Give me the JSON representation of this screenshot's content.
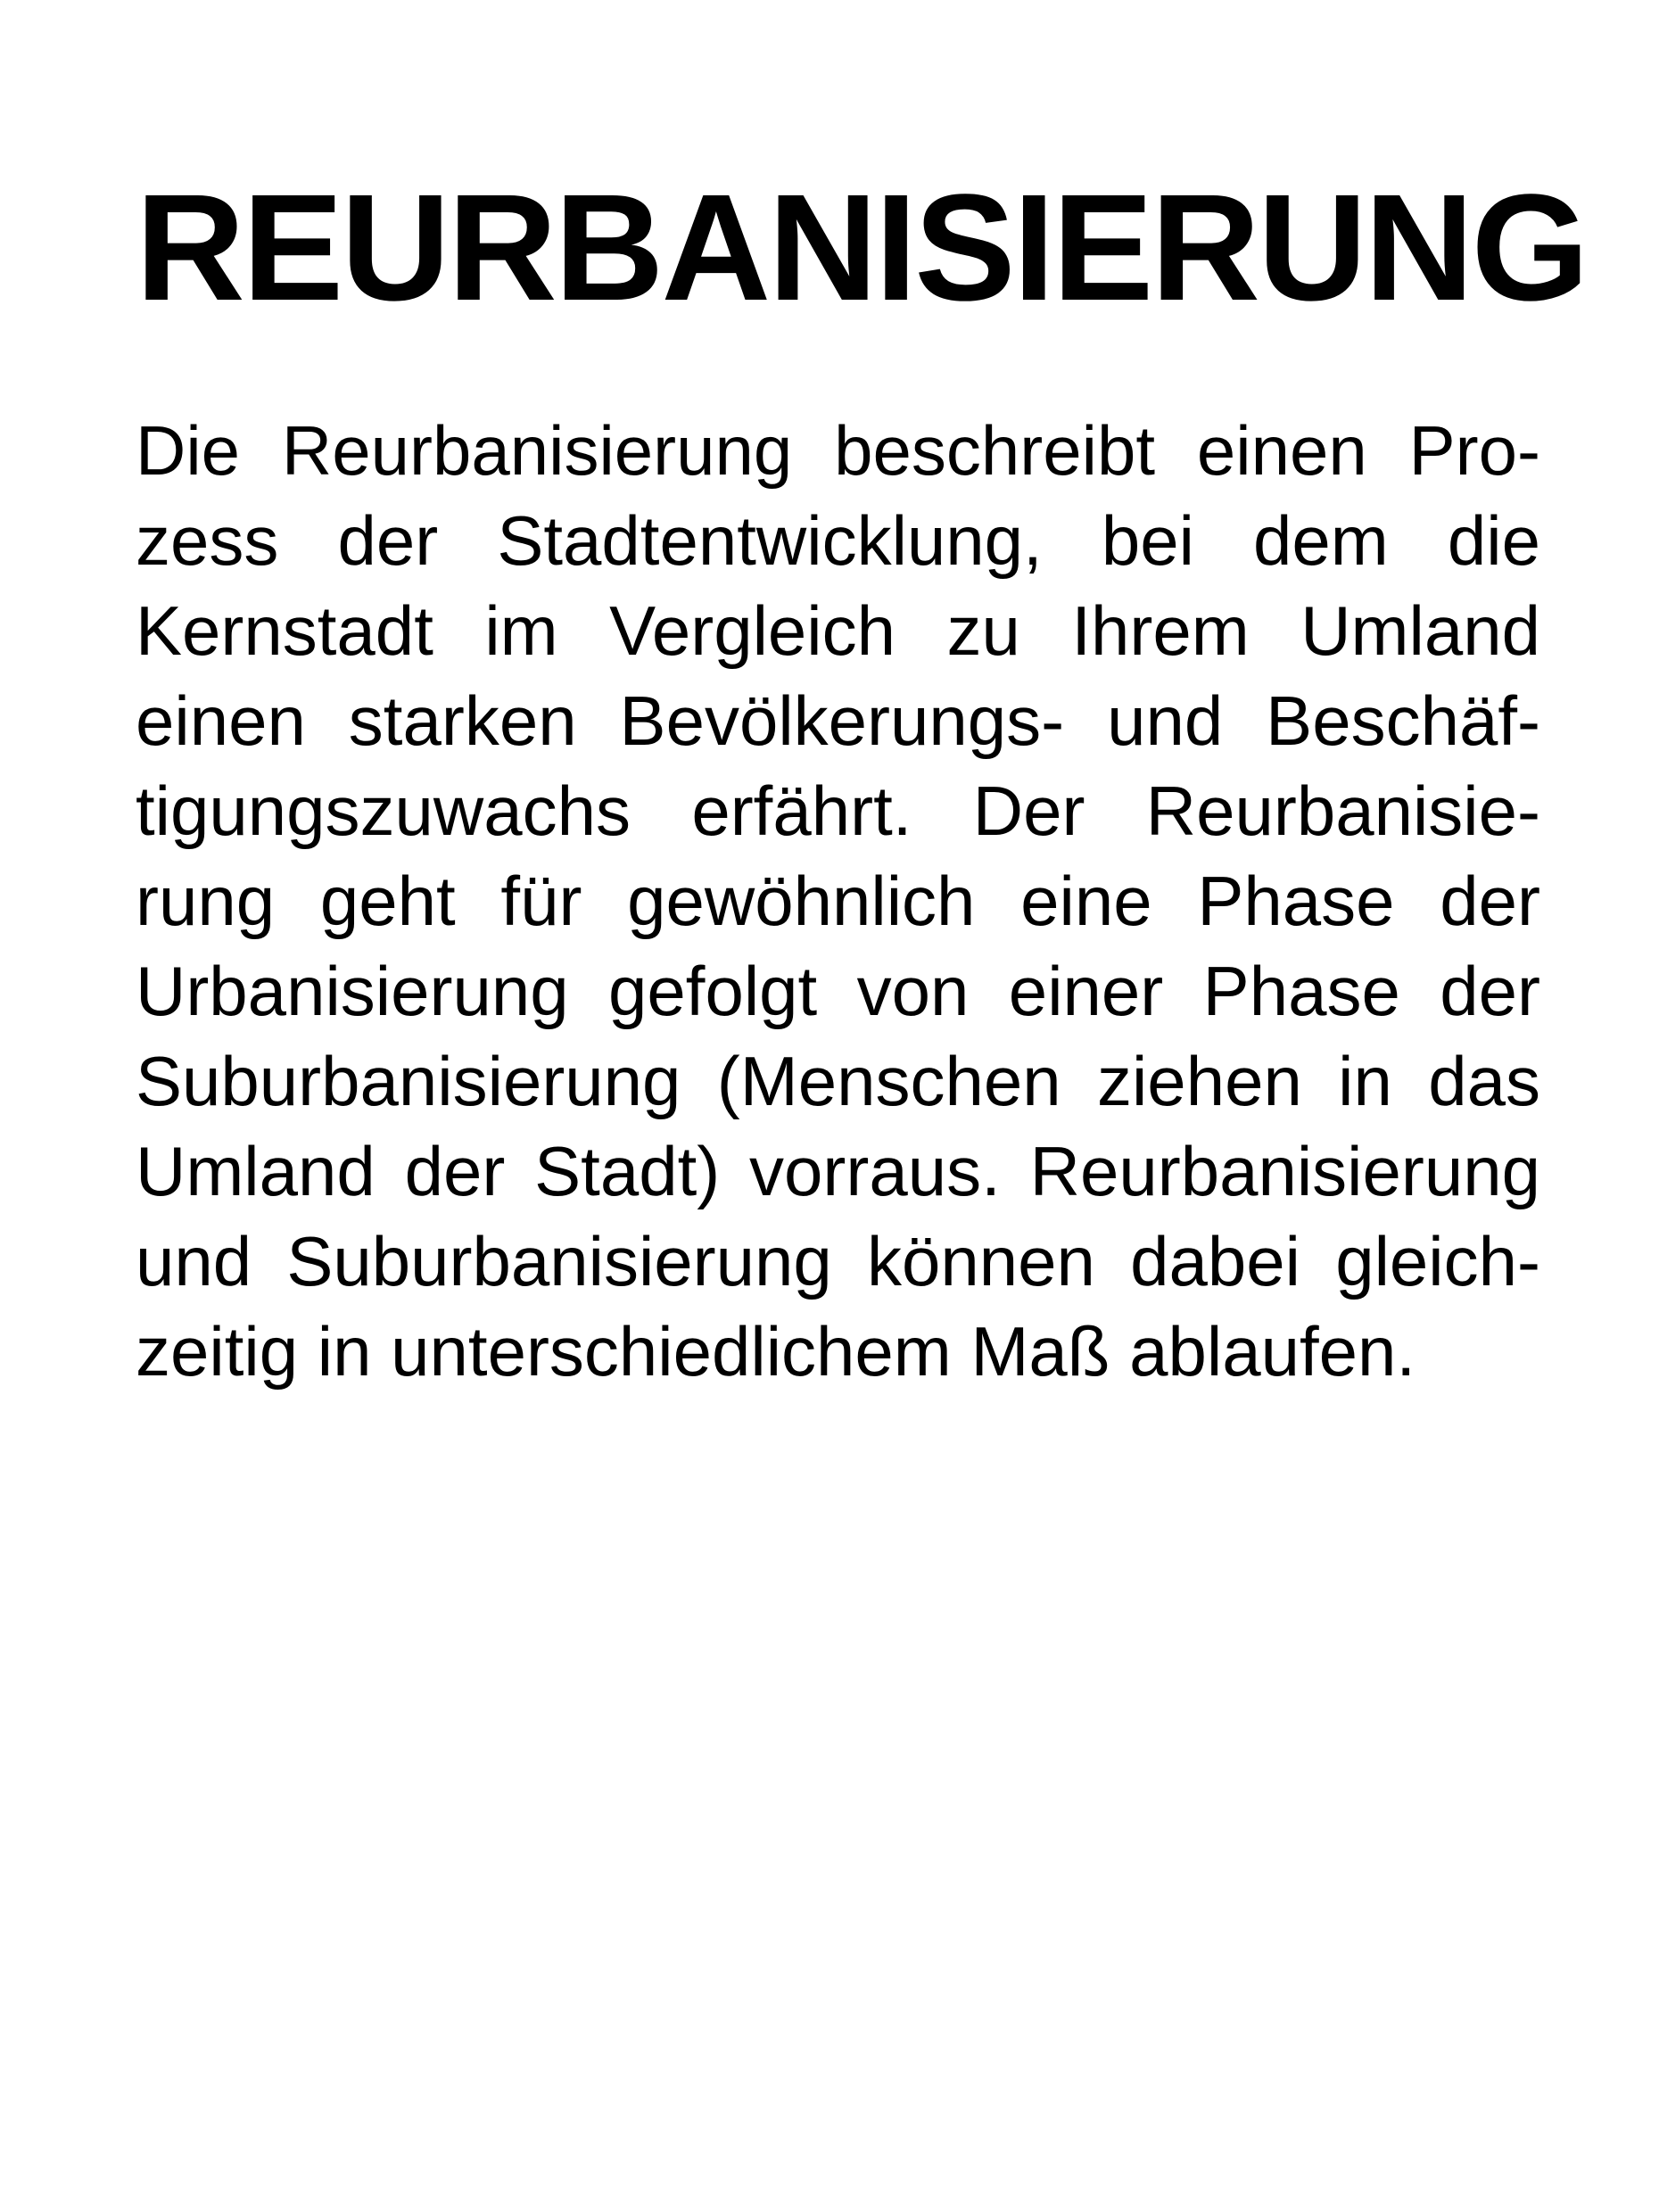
{
  "document": {
    "title": "REURBANISIERUNG",
    "lines": [
      "Die Reurbanisierung beschreibt einen Pro-",
      "zess der Stadtentwicklung, bei dem die",
      "Kernstadt im Vergleich zu Ihrem Umland",
      "einen starken Bevölkerungs- und Beschäf-",
      "tigungszuwachs erfährt. Der Reurbanisie-",
      "rung geht für gewöhnlich eine Phase der",
      "Urbanisierung gefolgt von einer Phase der",
      "Suburbanisierung (Menschen ziehen in das",
      "Umland der Stadt) vorraus. Reurbanisierung",
      "und Suburbanisierung können dabei gleich-",
      "zeitig in unterschiedlichem Maß ablaufen."
    ]
  }
}
